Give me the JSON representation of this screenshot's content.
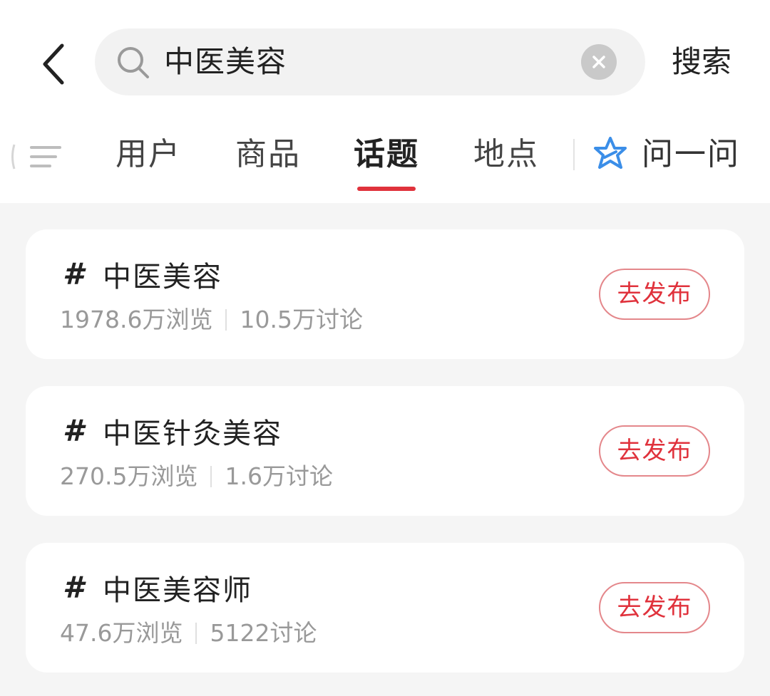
{
  "search": {
    "query": "中医美容",
    "submit_label": "搜索"
  },
  "tabs": [
    {
      "label": "用户",
      "active": false
    },
    {
      "label": "商品",
      "active": false
    },
    {
      "label": "话题",
      "active": true
    },
    {
      "label": "地点",
      "active": false
    }
  ],
  "ask": {
    "label": "问一问"
  },
  "colors": {
    "accent": "#e0323c",
    "ask_icon": "#3b8ee8"
  },
  "topics": [
    {
      "hash": "#",
      "title": "中医美容",
      "views": "1978.6万浏览",
      "discussions": "10.5万讨论",
      "button": "去发布"
    },
    {
      "hash": "#",
      "title": "中医针灸美容",
      "views": "270.5万浏览",
      "discussions": "1.6万讨论",
      "button": "去发布"
    },
    {
      "hash": "#",
      "title": "中医美容师",
      "views": "47.6万浏览",
      "discussions": "5122讨论",
      "button": "去发布"
    }
  ]
}
